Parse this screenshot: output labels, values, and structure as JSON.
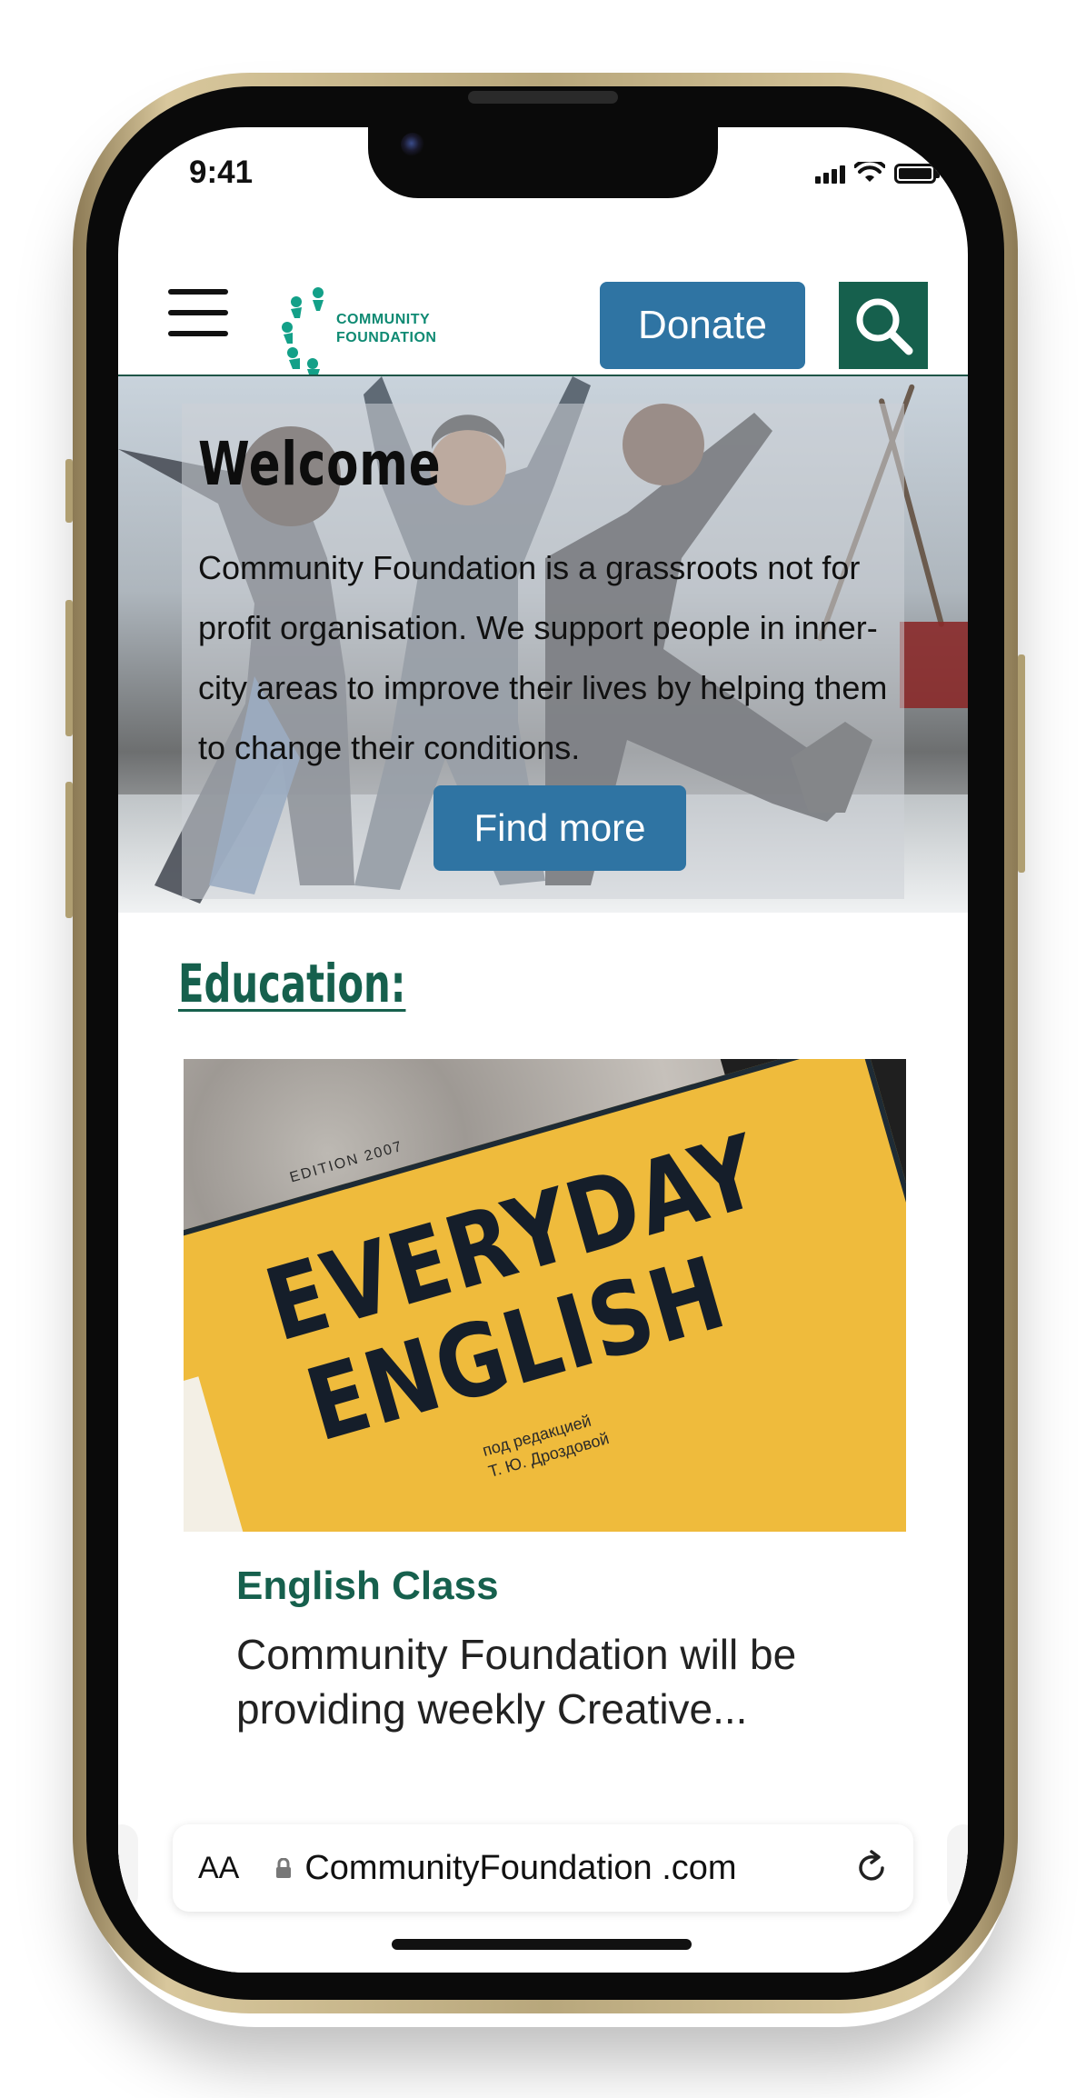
{
  "status_bar": {
    "time": "9:41"
  },
  "header": {
    "logo": {
      "line1": "COMMUNITY",
      "line2": "FOUNDATION"
    },
    "donate_label": "Donate"
  },
  "hero": {
    "title": "Welcome",
    "body": "Community Foundation is a grassroots not for profit organisation. We support people in inner-city areas to improve their lives by helping them to change their conditions.",
    "button_label": "Find more"
  },
  "education": {
    "heading": "Education:",
    "card": {
      "image_text": {
        "edition": "EDITION 2007",
        "title_line1": "EVERYDAY",
        "title_line2": "ENGLISH",
        "subtitle_line1": "под редакцией",
        "subtitle_line2": "Т. Ю. Дроздовой"
      },
      "title": "English Class",
      "description": "Community Foundation will be providing weekly Creative..."
    }
  },
  "browser": {
    "text_size_label": "AA",
    "url": "CommunityFoundation .com"
  },
  "colors": {
    "brand_green": "#16604d",
    "logo_teal": "#0f8a73",
    "button_blue": "#2f74a3"
  }
}
